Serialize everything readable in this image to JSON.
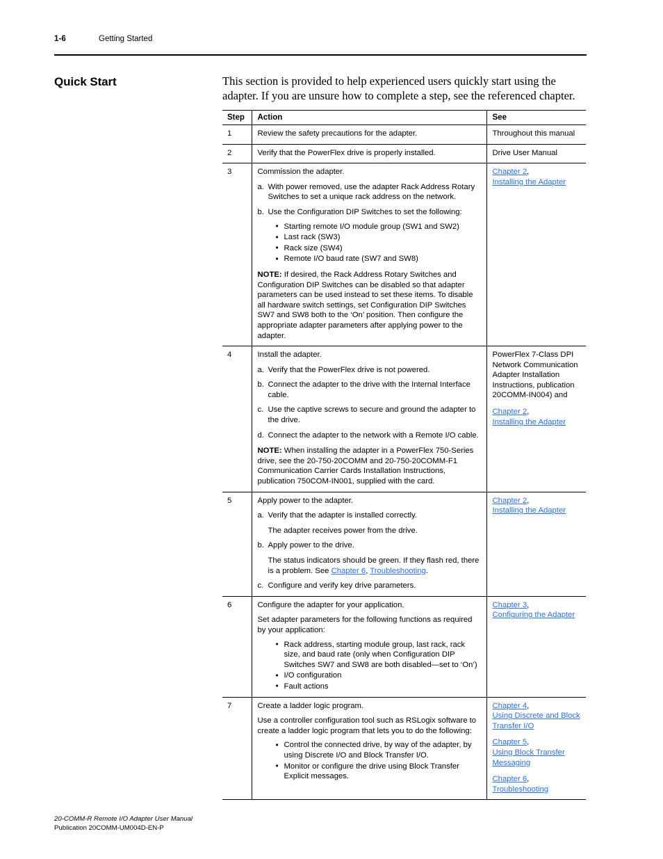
{
  "header": {
    "page_number": "1-6",
    "chapter_title": "Getting Started"
  },
  "section": {
    "heading": "Quick Start",
    "intro": "This section is provided to help experienced users quickly start using the adapter. If you are unsure how to complete a step, see the referenced chapter."
  },
  "table": {
    "columns": {
      "step": "Step",
      "action": "Action",
      "see": "See"
    },
    "rows": [
      {
        "step": "1",
        "action": {
          "lead": "Review the safety precautions for the adapter."
        },
        "see": {
          "plain": "Throughout this manual"
        }
      },
      {
        "step": "2",
        "action": {
          "lead": "Verify that the PowerFlex drive is properly installed."
        },
        "see": {
          "plain": "Drive User Manual"
        }
      },
      {
        "step": "3",
        "action": {
          "lead": "Commission the adapter.",
          "a_letter": "a.",
          "a_text": "With power removed, use the adapter Rack Address Rotary Switches to set a unique rack address on the network.",
          "b_letter": "b.",
          "b_text": "Use the Configuration DIP Switches to set the following:",
          "bullets": [
            "Starting remote I/O module group (SW1 and SW2)",
            "Last rack (SW3)",
            "Rack size (SW4)",
            "Remote I/O baud rate (SW7 and SW8)"
          ],
          "note_label": "NOTE:",
          "note_text": " If desired, the Rack Address Rotary Switches and Configuration DIP Switches can be disabled so that adapter parameters can be used instead to set these items. To disable all hardware switch settings, set Configuration DIP Switches SW7 and SW8 both to the ‘On’ position. Then configure the appropriate adapter parameters after applying power to the adapter."
        },
        "see": {
          "link_chapter": "Chapter 2",
          "link_comma": ",",
          "link_title": "Installing the Adapter"
        }
      },
      {
        "step": "4",
        "action": {
          "lead": "Install the adapter.",
          "a_letter": "a.",
          "a_text": "Verify that the PowerFlex drive is not powered.",
          "b_letter": "b.",
          "b_text": "Connect the adapter to the drive with the Internal Interface cable.",
          "c_letter": "c.",
          "c_text": "Use the captive screws to secure and ground the adapter to the drive.",
          "d_letter": "d.",
          "d_text": "Connect the adapter to the network with a Remote I/O cable.",
          "note_label": "NOTE:",
          "note_text": " When installing the adapter in a PowerFlex 750-Series drive, see the 20-750-20COMM and 20-750-20COMM-F1 Communication Carrier Cards Installation Instructions, publication 750COM-IN001, supplied with the card."
        },
        "see": {
          "plain": "PowerFlex 7-Class DPI Network Communication Adapter Installation Instructions, publication 20COMM-IN004) and",
          "link_chapter": "Chapter 2",
          "link_comma": ",",
          "link_title": "Installing the Adapter"
        }
      },
      {
        "step": "5",
        "action": {
          "lead": "Apply power to the adapter.",
          "a_letter": "a.",
          "a_text": "Verify that the adapter is installed correctly.",
          "a_sub": "The adapter receives power from the drive.",
          "b_letter": "b.",
          "b_text": "Apply power to the drive.",
          "b_sub_pre": "The status indicators should be green. If they flash red, there is a problem. See ",
          "b_sub_link1": "Chapter 6",
          "b_sub_mid": ", ",
          "b_sub_link2": "Troubleshooting",
          "b_sub_post": ".",
          "c_letter": "c.",
          "c_text": "Configure and verify key drive parameters."
        },
        "see": {
          "link_chapter": "Chapter 2",
          "link_comma": ",",
          "link_title": "Installing the Adapter"
        }
      },
      {
        "step": "6",
        "action": {
          "lead": "Configure the adapter for your application.",
          "para2": "Set adapter parameters for the following functions as required by your application:",
          "bullets": [
            "Rack address, starting module group, last rack, rack size, and baud rate (only when Configuration DIP Switches SW7 and SW8 are both disabled—set to ‘On’)",
            "I/O configuration",
            "Fault actions"
          ]
        },
        "see": {
          "link_chapter": "Chapter 3",
          "link_comma": ",",
          "link_title": "Configuring the Adapter"
        }
      },
      {
        "step": "7",
        "action": {
          "lead": "Create a ladder logic program.",
          "para2": "Use a controller configuration tool such as RSLogix software to create a ladder logic program that lets you to do the following:",
          "bullets": [
            "Control the connected drive, by way of the adapter, by using Discrete I/O and Block Transfer I/O.",
            "Monitor or configure the drive using Block Transfer Explicit messages."
          ]
        },
        "see": {
          "groups": [
            {
              "chapter": "Chapter 4",
              "comma": ",",
              "title": "Using Discrete and Block Transfer I/O"
            },
            {
              "chapter": "Chapter 5",
              "comma": ",",
              "title": "Using Block Transfer Messaging"
            },
            {
              "chapter": "Chapter 6",
              "comma": ",",
              "title": "Troubleshooting"
            }
          ]
        }
      }
    ]
  },
  "footer": {
    "manual_title": "20-COMM-R Remote I/O Adapter User Manual",
    "publication": "Publication 20COMM-UM004D-EN-P"
  },
  "colors": {
    "link": "#2a6fdb",
    "text": "#000000",
    "background": "#ffffff"
  }
}
